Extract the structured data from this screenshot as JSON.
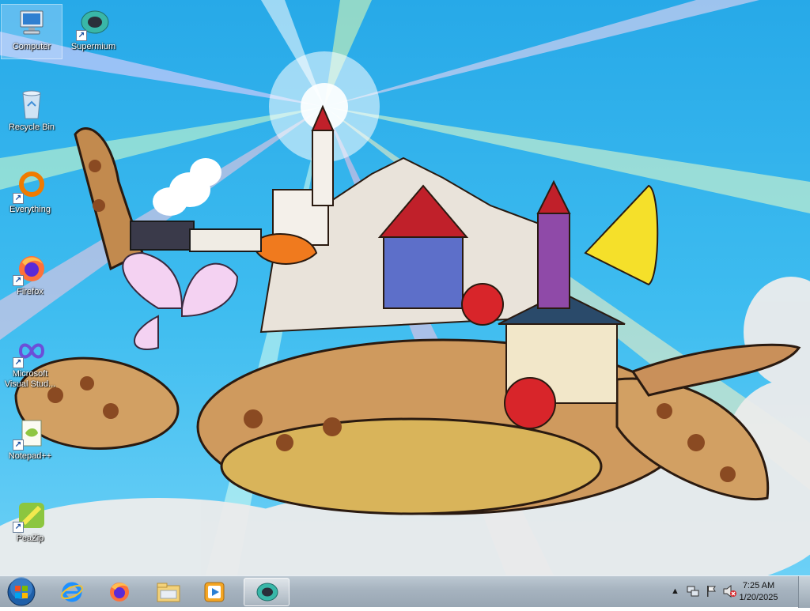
{
  "desktop": {
    "icons": [
      {
        "label": "Computer",
        "icon": "computer-icon"
      },
      {
        "label": "Supermium",
        "icon": "supermium-icon"
      },
      {
        "label": "Recycle Bin",
        "icon": "recycle-bin-icon"
      },
      {
        "label": "Everything",
        "icon": "everything-icon"
      },
      {
        "label": "Firefox",
        "icon": "firefox-icon"
      },
      {
        "label": "Microsoft Visual Stud...",
        "icon": "visual-studio-icon"
      },
      {
        "label": "Notepad++",
        "icon": "notepadpp-icon"
      },
      {
        "label": "PeaZip",
        "icon": "peazip-icon"
      }
    ]
  },
  "taskbar": {
    "pinned": [
      {
        "name": "Internet Explorer",
        "icon": "internet-explorer-icon"
      },
      {
        "name": "Firefox",
        "icon": "firefox-icon"
      },
      {
        "name": "Windows Explorer",
        "icon": "folder-icon"
      },
      {
        "name": "Windows Media Player",
        "icon": "media-player-icon"
      },
      {
        "name": "Supermium",
        "icon": "supermium-icon",
        "active": true
      }
    ],
    "tray": {
      "time": "7:25 AM",
      "date": "1/20/2025",
      "icons": [
        "show-hidden-icon",
        "network-icon",
        "action-center-flag-icon",
        "volume-muted-icon"
      ]
    }
  },
  "colors": {
    "sky": "#3fbdf0",
    "taskbar": "#a6b3bf",
    "firefox_orange": "#ff7139",
    "supermium_teal": "#39b7a8",
    "everything_orange": "#f07b00"
  }
}
